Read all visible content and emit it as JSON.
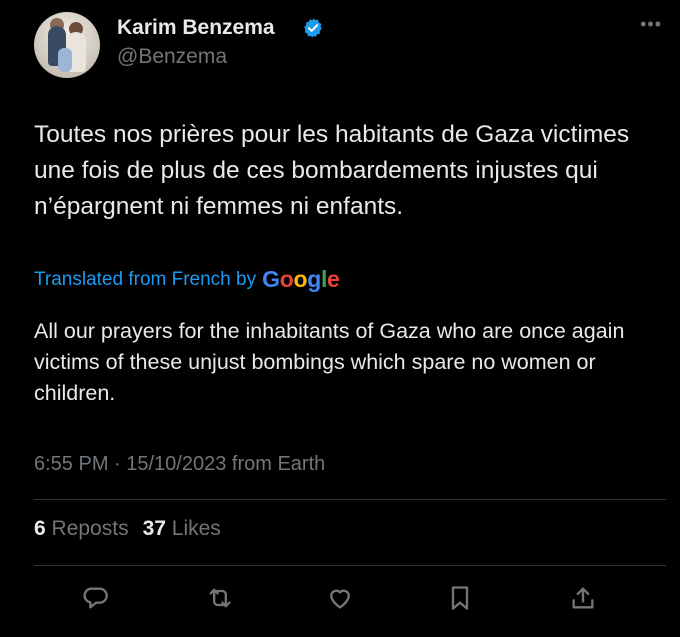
{
  "author": {
    "name": "Karim Benzema",
    "handle": "@Benzema",
    "verified": true,
    "avatar_icon": "avatar-photo"
  },
  "more_icon": "more-horizontal-icon",
  "tweet": {
    "original_text": "Toutes nos prières pour les habitants de Gaza victimes une fois de plus de ces bombardements injustes qui n’épargnent ni femmes ni enfants.",
    "translated_label": "Translated from French by",
    "translation_provider": "Google",
    "translation_text": "All our prayers for the inhabitants of Gaza who are once again victims of these unjust bombings which spare no women or children.",
    "timestamp": "6:55 PM · 15/10/2023 from Earth"
  },
  "stats": {
    "reposts_count": "6",
    "reposts_label": "Reposts",
    "likes_count": "37",
    "likes_label": "Likes"
  },
  "actions": [
    "reply-icon",
    "repost-icon",
    "like-icon",
    "bookmark-icon",
    "share-icon"
  ],
  "colors": {
    "background": "#000000",
    "text_primary": "#e7e9ea",
    "text_secondary": "#71767b",
    "accent": "#1d9bf0",
    "divider": "#2f3336"
  }
}
